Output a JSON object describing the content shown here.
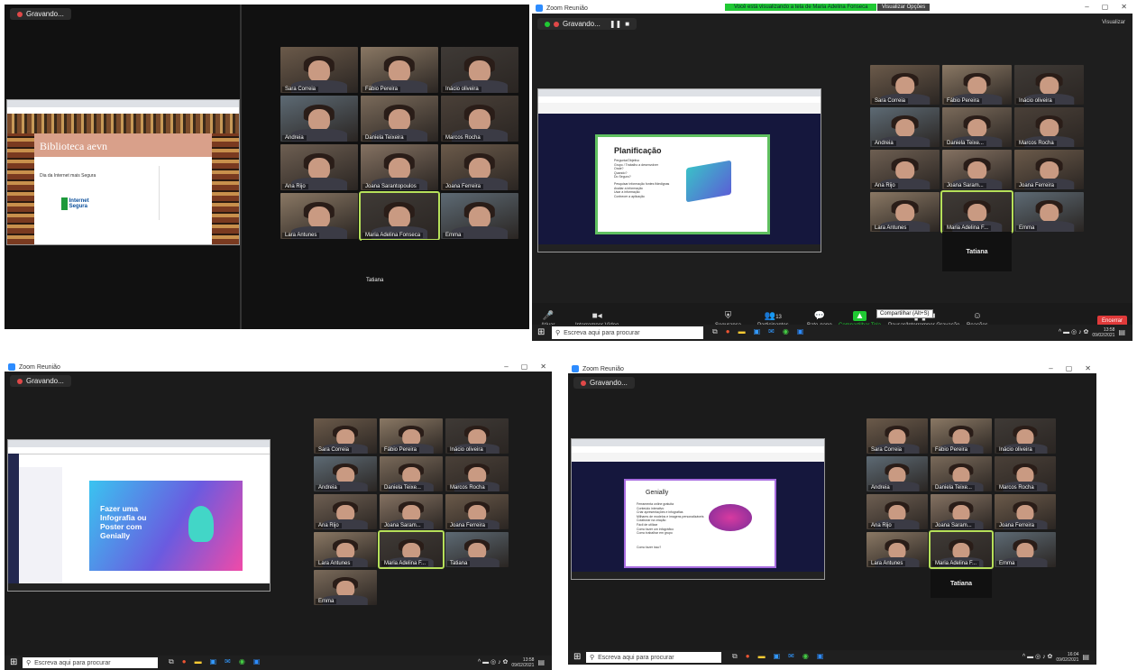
{
  "q1": {
    "badge": "Gravando...",
    "site_title": "Biblioteca aevn",
    "site_subtitle": "Dia da Internet mais Segura",
    "site_logo_text": "Internet Segura",
    "participants": [
      "Sara Correia",
      "Fábio Pereira",
      "Inácio oliveira",
      "Andreia",
      "Daniela Teixeira",
      "Marcos Rocha",
      "Ana Rijo",
      "Joana Sarantopoulos",
      "Joana Ferreira",
      "Lara Antunes",
      "Maria Adelina Fonseca",
      "Emma"
    ],
    "namecard": "Tatiana"
  },
  "q2": {
    "window_title": "Zoom Reunião",
    "banner": "Você está visualizando a tela de Maria Adelina Fonseca",
    "view_options": "Visualizar Opções",
    "badge": "Gravando...",
    "top_right": "Visualizar",
    "slide_title": "Planificação",
    "slide_lines": [
      "Pergunta/Objetivo",
      "Grupo / Trabalho a desenvolver",
      "Onde?",
      "Quando?",
      "Do Seguro?",
      "Pesquisar informação fontes fidedignas",
      "Avaliar a informação",
      "Usar a informação",
      "Conhecer a aplicação"
    ],
    "participants": [
      "Sara Correia",
      "Fábio Pereira",
      "Inácio oliveira",
      "Andreia",
      "Daniela Teixe...",
      "Marcos Rocha",
      "Ana Rijo",
      "Joana Saram...",
      "Joana Ferreira",
      "Lara Antunes",
      "Maria Adelina F...",
      "Emma"
    ],
    "namecard": "Tatiana",
    "toolbar": {
      "mute": "Ativar",
      "video": "Interromper Vídeo",
      "security": "Segurança",
      "participants": "Participantes",
      "participants_count": "13",
      "chat": "Bate-papo",
      "share": "Compartilhar Tela",
      "pause": "Pausar/Interromper Gravação",
      "reactions": "Reações",
      "record": "Encerrar"
    },
    "tooltip": "Compartilhar (Alt+S)",
    "search": "Escreva aqui para procurar",
    "time": "13:58",
    "date": "09/02/2021"
  },
  "q3": {
    "window_title": "Zoom Reunião",
    "badge": "Gravando...",
    "slide_title": "Fazer uma Infografia ou Poster com Genially",
    "participants": [
      "Sara Correia",
      "Fábio Pereira",
      "Inácio oliveira",
      "Andreia",
      "Daniela Teixe...",
      "Marcos Rocha",
      "Ana Rijo",
      "Joana Saram...",
      "Joana Ferreira",
      "Lara Antunes",
      "Maria Adelina F...",
      "Tatiana",
      "Emma"
    ],
    "search": "Escreva aqui para procurar",
    "time": "13:58",
    "date": "09/02/2021"
  },
  "q4": {
    "window_title": "Zoom Reunião",
    "badge": "Gravando...",
    "slide_title": "Genially",
    "slide_lines": [
      "Ferramenta online gratuita",
      "Conteúdo interativo",
      "Criar apresentações e infografias",
      "Milhares de modelos e imagens personalizáveis",
      "Colaborar na criação",
      "Fácil de utilizar",
      "Como fazer um infográfico",
      "Como trabalhar em grupo"
    ],
    "slide_footer": "Como fazer isso?",
    "participants": [
      "Sara Correia",
      "Fábio Pereira",
      "Inácio oliveira",
      "Andreia",
      "Daniela Teixe...",
      "Marcos Rocha",
      "Ana Rijo",
      "Joana Saram...",
      "Joana Ferreira",
      "Lara Antunes",
      "Maria Adelina F...",
      "Emma"
    ],
    "namecard": "Tatiana",
    "search": "Escreva aqui para procurar",
    "time": "16:04",
    "date": "09/02/2021"
  },
  "colors": {
    "active_border": "#b6e05a",
    "banner": "#20c933",
    "record": "#e03a3a",
    "zoom_blue": "#2d8cff"
  }
}
